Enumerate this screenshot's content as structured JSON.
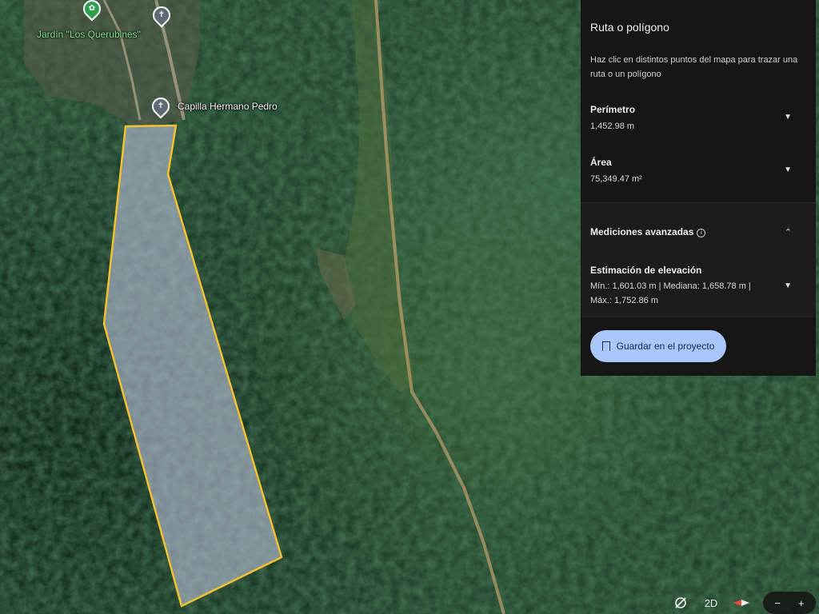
{
  "map": {
    "poi": [
      {
        "name": "Jardín \"Los Querubines\"",
        "style": "green"
      },
      {
        "name": "Capilla Hermano Pedro",
        "style": "grey"
      }
    ],
    "polygon_color": "#f2c030",
    "polygon_fill": "#b8bfd6"
  },
  "panel": {
    "title": "Ruta o polígono",
    "description": "Haz clic en distintos puntos del mapa para trazar una ruta o un polígono",
    "perimeter_label": "Perímetro",
    "perimeter_value": "1,452.98 m",
    "area_label": "Área",
    "area_value": "75,349.47 m²",
    "advanced_label": "Mediciones avanzadas",
    "elevation_label": "Estimación de elevación",
    "elevation_line1": "Mín.: 1,601.03 m | Mediana: 1,658.78 m |",
    "elevation_line2": "Máx.: 1,752.86 m",
    "save_label": "Guardar en el proyecto"
  },
  "controls": {
    "view_mode": "2D",
    "zoom_out": "−",
    "zoom_in": "+"
  },
  "colors": {
    "panel_bg": "#161616",
    "button_bg": "#a9c7fa"
  }
}
